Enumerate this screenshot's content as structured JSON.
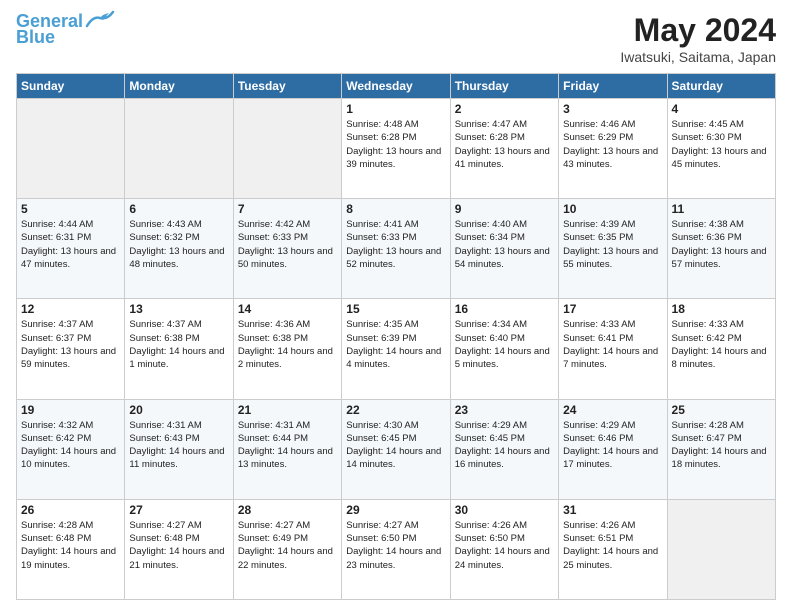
{
  "logo": {
    "line1": "General",
    "line2": "Blue"
  },
  "title": "May 2024",
  "location": "Iwatsuki, Saitama, Japan",
  "days_of_week": [
    "Sunday",
    "Monday",
    "Tuesday",
    "Wednesday",
    "Thursday",
    "Friday",
    "Saturday"
  ],
  "weeks": [
    [
      {
        "day": "",
        "info": ""
      },
      {
        "day": "",
        "info": ""
      },
      {
        "day": "",
        "info": ""
      },
      {
        "day": "1",
        "info": "Sunrise: 4:48 AM\nSunset: 6:28 PM\nDaylight: 13 hours\nand 39 minutes."
      },
      {
        "day": "2",
        "info": "Sunrise: 4:47 AM\nSunset: 6:28 PM\nDaylight: 13 hours\nand 41 minutes."
      },
      {
        "day": "3",
        "info": "Sunrise: 4:46 AM\nSunset: 6:29 PM\nDaylight: 13 hours\nand 43 minutes."
      },
      {
        "day": "4",
        "info": "Sunrise: 4:45 AM\nSunset: 6:30 PM\nDaylight: 13 hours\nand 45 minutes."
      }
    ],
    [
      {
        "day": "5",
        "info": "Sunrise: 4:44 AM\nSunset: 6:31 PM\nDaylight: 13 hours\nand 47 minutes."
      },
      {
        "day": "6",
        "info": "Sunrise: 4:43 AM\nSunset: 6:32 PM\nDaylight: 13 hours\nand 48 minutes."
      },
      {
        "day": "7",
        "info": "Sunrise: 4:42 AM\nSunset: 6:33 PM\nDaylight: 13 hours\nand 50 minutes."
      },
      {
        "day": "8",
        "info": "Sunrise: 4:41 AM\nSunset: 6:33 PM\nDaylight: 13 hours\nand 52 minutes."
      },
      {
        "day": "9",
        "info": "Sunrise: 4:40 AM\nSunset: 6:34 PM\nDaylight: 13 hours\nand 54 minutes."
      },
      {
        "day": "10",
        "info": "Sunrise: 4:39 AM\nSunset: 6:35 PM\nDaylight: 13 hours\nand 55 minutes."
      },
      {
        "day": "11",
        "info": "Sunrise: 4:38 AM\nSunset: 6:36 PM\nDaylight: 13 hours\nand 57 minutes."
      }
    ],
    [
      {
        "day": "12",
        "info": "Sunrise: 4:37 AM\nSunset: 6:37 PM\nDaylight: 13 hours\nand 59 minutes."
      },
      {
        "day": "13",
        "info": "Sunrise: 4:37 AM\nSunset: 6:38 PM\nDaylight: 14 hours\nand 1 minute."
      },
      {
        "day": "14",
        "info": "Sunrise: 4:36 AM\nSunset: 6:38 PM\nDaylight: 14 hours\nand 2 minutes."
      },
      {
        "day": "15",
        "info": "Sunrise: 4:35 AM\nSunset: 6:39 PM\nDaylight: 14 hours\nand 4 minutes."
      },
      {
        "day": "16",
        "info": "Sunrise: 4:34 AM\nSunset: 6:40 PM\nDaylight: 14 hours\nand 5 minutes."
      },
      {
        "day": "17",
        "info": "Sunrise: 4:33 AM\nSunset: 6:41 PM\nDaylight: 14 hours\nand 7 minutes."
      },
      {
        "day": "18",
        "info": "Sunrise: 4:33 AM\nSunset: 6:42 PM\nDaylight: 14 hours\nand 8 minutes."
      }
    ],
    [
      {
        "day": "19",
        "info": "Sunrise: 4:32 AM\nSunset: 6:42 PM\nDaylight: 14 hours\nand 10 minutes."
      },
      {
        "day": "20",
        "info": "Sunrise: 4:31 AM\nSunset: 6:43 PM\nDaylight: 14 hours\nand 11 minutes."
      },
      {
        "day": "21",
        "info": "Sunrise: 4:31 AM\nSunset: 6:44 PM\nDaylight: 14 hours\nand 13 minutes."
      },
      {
        "day": "22",
        "info": "Sunrise: 4:30 AM\nSunset: 6:45 PM\nDaylight: 14 hours\nand 14 minutes."
      },
      {
        "day": "23",
        "info": "Sunrise: 4:29 AM\nSunset: 6:45 PM\nDaylight: 14 hours\nand 16 minutes."
      },
      {
        "day": "24",
        "info": "Sunrise: 4:29 AM\nSunset: 6:46 PM\nDaylight: 14 hours\nand 17 minutes."
      },
      {
        "day": "25",
        "info": "Sunrise: 4:28 AM\nSunset: 6:47 PM\nDaylight: 14 hours\nand 18 minutes."
      }
    ],
    [
      {
        "day": "26",
        "info": "Sunrise: 4:28 AM\nSunset: 6:48 PM\nDaylight: 14 hours\nand 19 minutes."
      },
      {
        "day": "27",
        "info": "Sunrise: 4:27 AM\nSunset: 6:48 PM\nDaylight: 14 hours\nand 21 minutes."
      },
      {
        "day": "28",
        "info": "Sunrise: 4:27 AM\nSunset: 6:49 PM\nDaylight: 14 hours\nand 22 minutes."
      },
      {
        "day": "29",
        "info": "Sunrise: 4:27 AM\nSunset: 6:50 PM\nDaylight: 14 hours\nand 23 minutes."
      },
      {
        "day": "30",
        "info": "Sunrise: 4:26 AM\nSunset: 6:50 PM\nDaylight: 14 hours\nand 24 minutes."
      },
      {
        "day": "31",
        "info": "Sunrise: 4:26 AM\nSunset: 6:51 PM\nDaylight: 14 hours\nand 25 minutes."
      },
      {
        "day": "",
        "info": ""
      }
    ]
  ]
}
